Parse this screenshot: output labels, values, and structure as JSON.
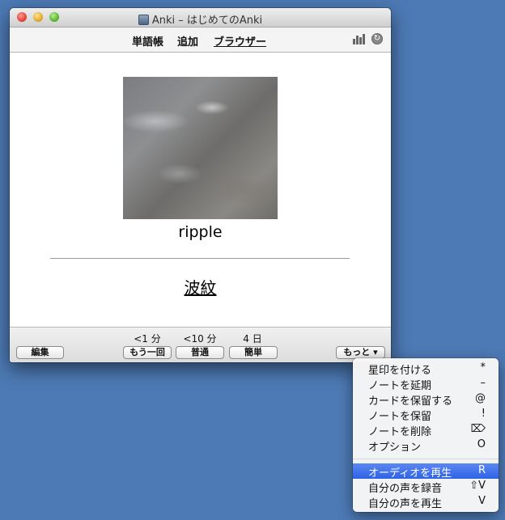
{
  "window": {
    "title": "Anki – はじめてのAnki"
  },
  "toolbar": {
    "links": [
      "単語帳",
      "追加",
      "ブラウザー"
    ],
    "active_index": 2
  },
  "card": {
    "front": "ripple",
    "back": "波紋"
  },
  "bottom": {
    "edit": "編集",
    "intervals": [
      "<1 分",
      "<10 分",
      "4 日"
    ],
    "answers": [
      "もう一回",
      "普通",
      "簡単"
    ],
    "more": "もっと ▾"
  },
  "menu": {
    "items": [
      {
        "label": "星印を付ける",
        "key": "*"
      },
      {
        "label": "ノートを延期",
        "key": "–"
      },
      {
        "label": "カードを保留する",
        "key": "@"
      },
      {
        "label": "ノートを保留",
        "key": "!"
      },
      {
        "label": "ノートを削除",
        "key": "⌦"
      },
      {
        "label": "オプション",
        "key": "O"
      },
      {
        "label": "オーディオを再生",
        "key": "R"
      },
      {
        "label": "自分の声を録音",
        "key": "⇧V"
      },
      {
        "label": "自分の声を再生",
        "key": "V"
      }
    ],
    "highlighted_index": 6
  },
  "colors": {
    "desktop": "#4d7ab5",
    "highlight": "#3a6ee8"
  }
}
